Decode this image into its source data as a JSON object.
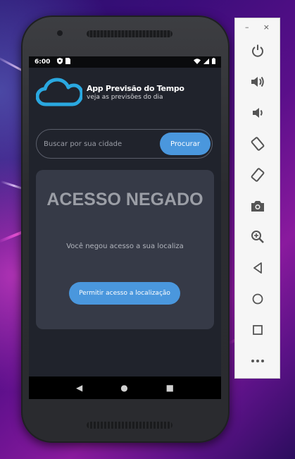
{
  "status_bar": {
    "time": "6:00"
  },
  "app": {
    "title": "App Previsão do Tempo",
    "subtitle": "veja as previsões do dia"
  },
  "search": {
    "placeholder": "Buscar por sua cidade",
    "button_label": "Procurar"
  },
  "card": {
    "title": "ACESSO NEGADO",
    "message": "Você negou acesso a sua localiza",
    "button_label": "Permitir acesso a localização"
  },
  "nav": {
    "back": "◀",
    "home": "●",
    "recents": "■"
  },
  "colors": {
    "accent": "#4a97dd",
    "screen_bg": "#20232c",
    "card_bg": "#363a47",
    "logo": "#2aa8e0"
  },
  "emulator_toolbar": {
    "minimize": "–",
    "close": "×",
    "buttons": [
      "power-icon",
      "volume-up-icon",
      "volume-down-icon",
      "rotate-left-icon",
      "rotate-right-icon",
      "camera-icon",
      "zoom-icon",
      "back-icon",
      "home-icon",
      "overview-icon",
      "more-icon"
    ]
  }
}
